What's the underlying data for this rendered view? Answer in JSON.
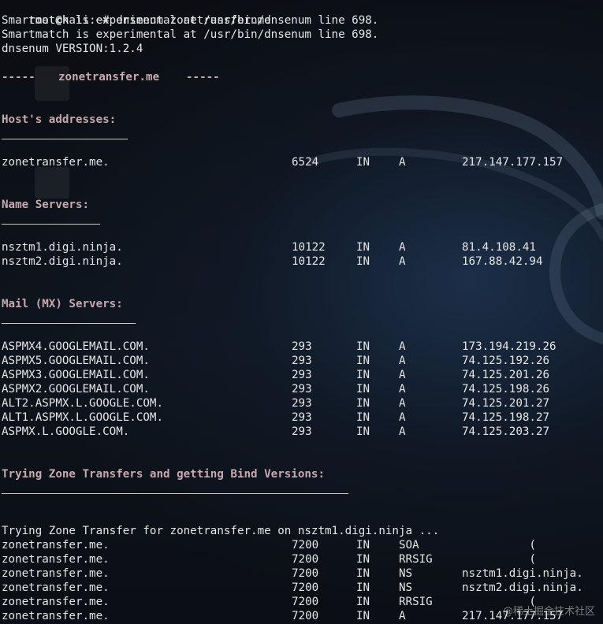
{
  "prompt": {
    "user_host": "root@kali",
    "path_symbol": ":~# ",
    "command": "dnsenum zonetransfer.me"
  },
  "preamble": [
    "Smartmatch is experimental at /usr/bin/dnsenum line 698.",
    "Smartmatch is experimental at /usr/bin/dnsenum line 698.",
    "dnsenum VERSION:1.2.4"
  ],
  "domain_separator": {
    "left": "-----",
    "domain": "zonetransfer.me",
    "right": "-----"
  },
  "sections": {
    "hosts": {
      "title": "Host's addresses:"
    },
    "ns": {
      "title": "Name Servers:"
    },
    "mx": {
      "title": "Mail (MX) Servers:"
    },
    "zt": {
      "title": "Trying Zone Transfers and getting Bind Versions:"
    }
  },
  "host_records": [
    {
      "name": "zonetransfer.me.",
      "ttl": "6524",
      "class": "IN",
      "type": "A",
      "value": "217.147.177.157"
    }
  ],
  "ns_records": [
    {
      "name": "nsztm1.digi.ninja.",
      "ttl": "10122",
      "class": "IN",
      "type": "A",
      "value": "81.4.108.41"
    },
    {
      "name": "nsztm2.digi.ninja.",
      "ttl": "10122",
      "class": "IN",
      "type": "A",
      "value": "167.88.42.94"
    }
  ],
  "mx_records": [
    {
      "name": "ASPMX4.GOOGLEMAIL.COM.",
      "ttl": "293",
      "class": "IN",
      "type": "A",
      "value": "173.194.219.26"
    },
    {
      "name": "ASPMX5.GOOGLEMAIL.COM.",
      "ttl": "293",
      "class": "IN",
      "type": "A",
      "value": "74.125.192.26"
    },
    {
      "name": "ASPMX3.GOOGLEMAIL.COM.",
      "ttl": "293",
      "class": "IN",
      "type": "A",
      "value": "74.125.201.26"
    },
    {
      "name": "ASPMX2.GOOGLEMAIL.COM.",
      "ttl": "293",
      "class": "IN",
      "type": "A",
      "value": "74.125.198.26"
    },
    {
      "name": "ALT2.ASPMX.L.GOOGLE.COM.",
      "ttl": "293",
      "class": "IN",
      "type": "A",
      "value": "74.125.201.27"
    },
    {
      "name": "ALT1.ASPMX.L.GOOGLE.COM.",
      "ttl": "293",
      "class": "IN",
      "type": "A",
      "value": "74.125.198.27"
    },
    {
      "name": "ASPMX.L.GOOGLE.COM.",
      "ttl": "293",
      "class": "IN",
      "type": "A",
      "value": "74.125.203.27"
    }
  ],
  "zt_status": "Trying Zone Transfer for zonetransfer.me on nsztm1.digi.ninja ...",
  "zt_records": [
    {
      "name": "zonetransfer.me.",
      "ttl": "7200",
      "class": "IN",
      "type": "SOA",
      "value": "          ("
    },
    {
      "name": "zonetransfer.me.",
      "ttl": "7200",
      "class": "IN",
      "type": "RRSIG",
      "value": "          ("
    },
    {
      "name": "zonetransfer.me.",
      "ttl": "7200",
      "class": "IN",
      "type": "NS",
      "value": "nsztm1.digi.ninja."
    },
    {
      "name": "zonetransfer.me.",
      "ttl": "7200",
      "class": "IN",
      "type": "NS",
      "value": "nsztm2.digi.ninja."
    },
    {
      "name": "zonetransfer.me.",
      "ttl": "7200",
      "class": "IN",
      "type": "RRSIG",
      "value": "          ("
    },
    {
      "name": "zonetransfer.me.",
      "ttl": "7200",
      "class": "IN",
      "type": "A",
      "value": "217.147.177.157"
    }
  ],
  "watermark": "@稀土掘金技术社区"
}
